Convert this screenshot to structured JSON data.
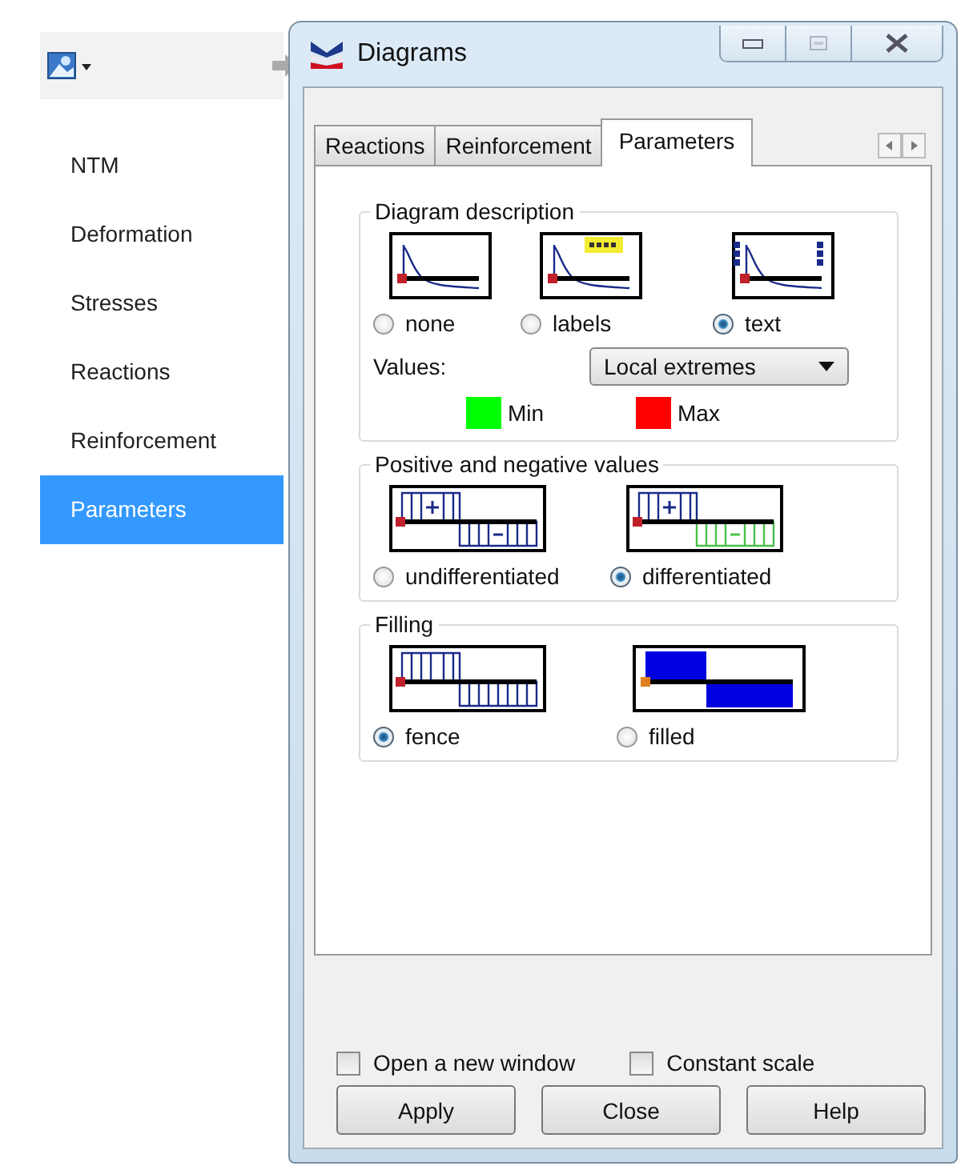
{
  "sidebar": {
    "items": [
      {
        "label": "NTM",
        "selected": false
      },
      {
        "label": "Deformation",
        "selected": false
      },
      {
        "label": "Stresses",
        "selected": false
      },
      {
        "label": "Reactions",
        "selected": false
      },
      {
        "label": "Reinforcement",
        "selected": false
      },
      {
        "label": "Parameters",
        "selected": true
      }
    ]
  },
  "window": {
    "title": "Diagrams"
  },
  "tabs": [
    {
      "label": "Reactions",
      "selected": false
    },
    {
      "label": "Reinforcement",
      "selected": false
    },
    {
      "label": "Parameters",
      "selected": true
    }
  ],
  "groups": [
    {
      "title": "Diagram description",
      "options": [
        {
          "label": "none",
          "selected": false,
          "kind": "decay"
        },
        {
          "label": "labels",
          "selected": false,
          "kind": "decay-labels"
        },
        {
          "label": "text",
          "selected": true,
          "kind": "decay-text"
        }
      ],
      "values": {
        "label": "Values:",
        "value": "Local extremes"
      },
      "legend": [
        {
          "label": "Min",
          "color": "#00ff00"
        },
        {
          "label": "Max",
          "color": "#ff0000"
        }
      ]
    },
    {
      "title": "Positive and negative values",
      "options": [
        {
          "label": "undifferentiated",
          "selected": false,
          "kind": "fence-sign"
        },
        {
          "label": "differentiated",
          "selected": true,
          "kind": "fence-sign-green"
        }
      ]
    },
    {
      "title": "Filling",
      "options": [
        {
          "label": "fence",
          "selected": true,
          "kind": "fence"
        },
        {
          "label": "filled",
          "selected": false,
          "kind": "filled"
        }
      ]
    }
  ],
  "checkboxes": [
    {
      "label": "Open a new window",
      "checked": false
    },
    {
      "label": "Constant scale",
      "checked": false
    }
  ],
  "buttons": [
    "Apply",
    "Close",
    "Help"
  ]
}
